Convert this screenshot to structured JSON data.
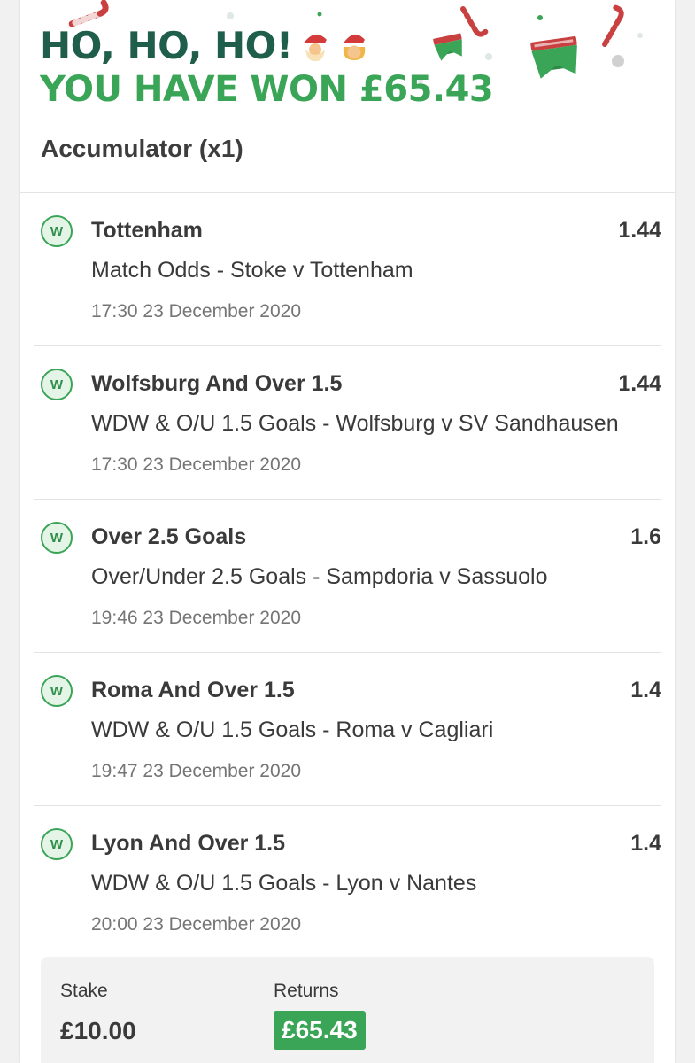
{
  "banner": {
    "line1": "HO, HO, HO!",
    "line2": "YOU HAVE WON £65.43",
    "colors": {
      "dark": "#1f5e4a",
      "green": "#3aa457"
    },
    "icons": [
      "santa-emoji",
      "mrs-claus-emoji",
      "candy-cane-icon",
      "underpants-icon",
      "snowflake-dots"
    ]
  },
  "bet": {
    "title": "Accumulator (x1)"
  },
  "legs": [
    {
      "status": "W",
      "selection": "Tottenham",
      "odds": "1.44",
      "market": "Match Odds - Stoke v Tottenham",
      "time": "17:30 23 December 2020"
    },
    {
      "status": "W",
      "selection": "Wolfsburg And Over 1.5",
      "odds": "1.44",
      "market": "WDW & O/U 1.5 Goals - Wolfsburg v SV Sandhausen",
      "time": "17:30 23 December 2020"
    },
    {
      "status": "W",
      "selection": "Over 2.5 Goals",
      "odds": "1.6",
      "market": "Over/Under 2.5 Goals - Sampdoria v Sassuolo",
      "time": "19:46 23 December 2020"
    },
    {
      "status": "W",
      "selection": "Roma And Over 1.5",
      "odds": "1.4",
      "market": "WDW & O/U 1.5 Goals - Roma v Cagliari",
      "time": "19:47 23 December 2020"
    },
    {
      "status": "W",
      "selection": "Lyon And Over 1.5",
      "odds": "1.4",
      "market": "WDW & O/U 1.5 Goals - Lyon v Nantes",
      "time": "20:00 23 December 2020"
    }
  ],
  "summary": {
    "stake_label": "Stake",
    "stake_value": "£10.00",
    "returns_label": "Returns",
    "returns_value": "£65.43"
  }
}
